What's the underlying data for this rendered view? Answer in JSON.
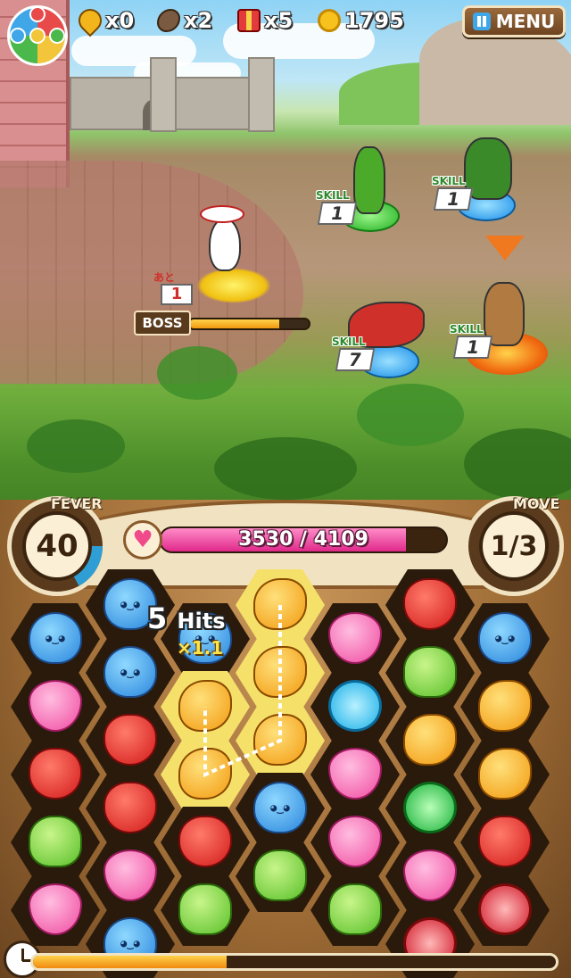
{
  "hud": {
    "drops": "x0",
    "seeds": "x2",
    "boxes": "x5",
    "coins": "1795",
    "menu_label": "MENU"
  },
  "battle": {
    "boss_label": "BOSS",
    "boss_hp_fraction": 0.75,
    "ato_label": "あと",
    "ato_turns": "1",
    "skill_label": "SKILL",
    "enemies": [
      {
        "name": "cucumber-samurai",
        "skill_turns": "1"
      },
      {
        "name": "green-duck-warrior",
        "skill_turns": "1"
      },
      {
        "name": "red-fish-warrior",
        "skill_turns": "7"
      },
      {
        "name": "helmet-soldier",
        "skill_turns": "1"
      }
    ]
  },
  "status": {
    "fever_label": "FEVER",
    "fever_value": "40",
    "fever_fraction": 0.17,
    "move_label": "MOVE",
    "move_value": "1/3",
    "hp_text": "3530 / 4109",
    "hp_current": 3530,
    "hp_max": 4109
  },
  "combo": {
    "hits_number": "5",
    "hits_label": "Hits",
    "multiplier": "×1.1"
  },
  "timer": {
    "fraction": 0.37
  },
  "board": {
    "columns": [
      [
        "blue",
        "pink",
        "red",
        "green",
        "pink"
      ],
      [
        "blue",
        "blue",
        "red",
        "red",
        "pink",
        "blue"
      ],
      [
        "blue",
        "yellow",
        "yellow",
        "red",
        "green"
      ],
      [
        "yellow",
        "yellow",
        "yellow",
        "blue",
        "green"
      ],
      [
        "pink",
        "coin-blue",
        "pink",
        "pink",
        "green"
      ],
      [
        "red",
        "green",
        "yellow",
        "coin-green",
        "pink",
        "coin-red"
      ],
      [
        "blue",
        "yellow",
        "yellow",
        "red",
        "coin-red"
      ]
    ],
    "lit_cells": [
      "2-1",
      "2-2",
      "3-0",
      "3-1",
      "3-2"
    ]
  }
}
